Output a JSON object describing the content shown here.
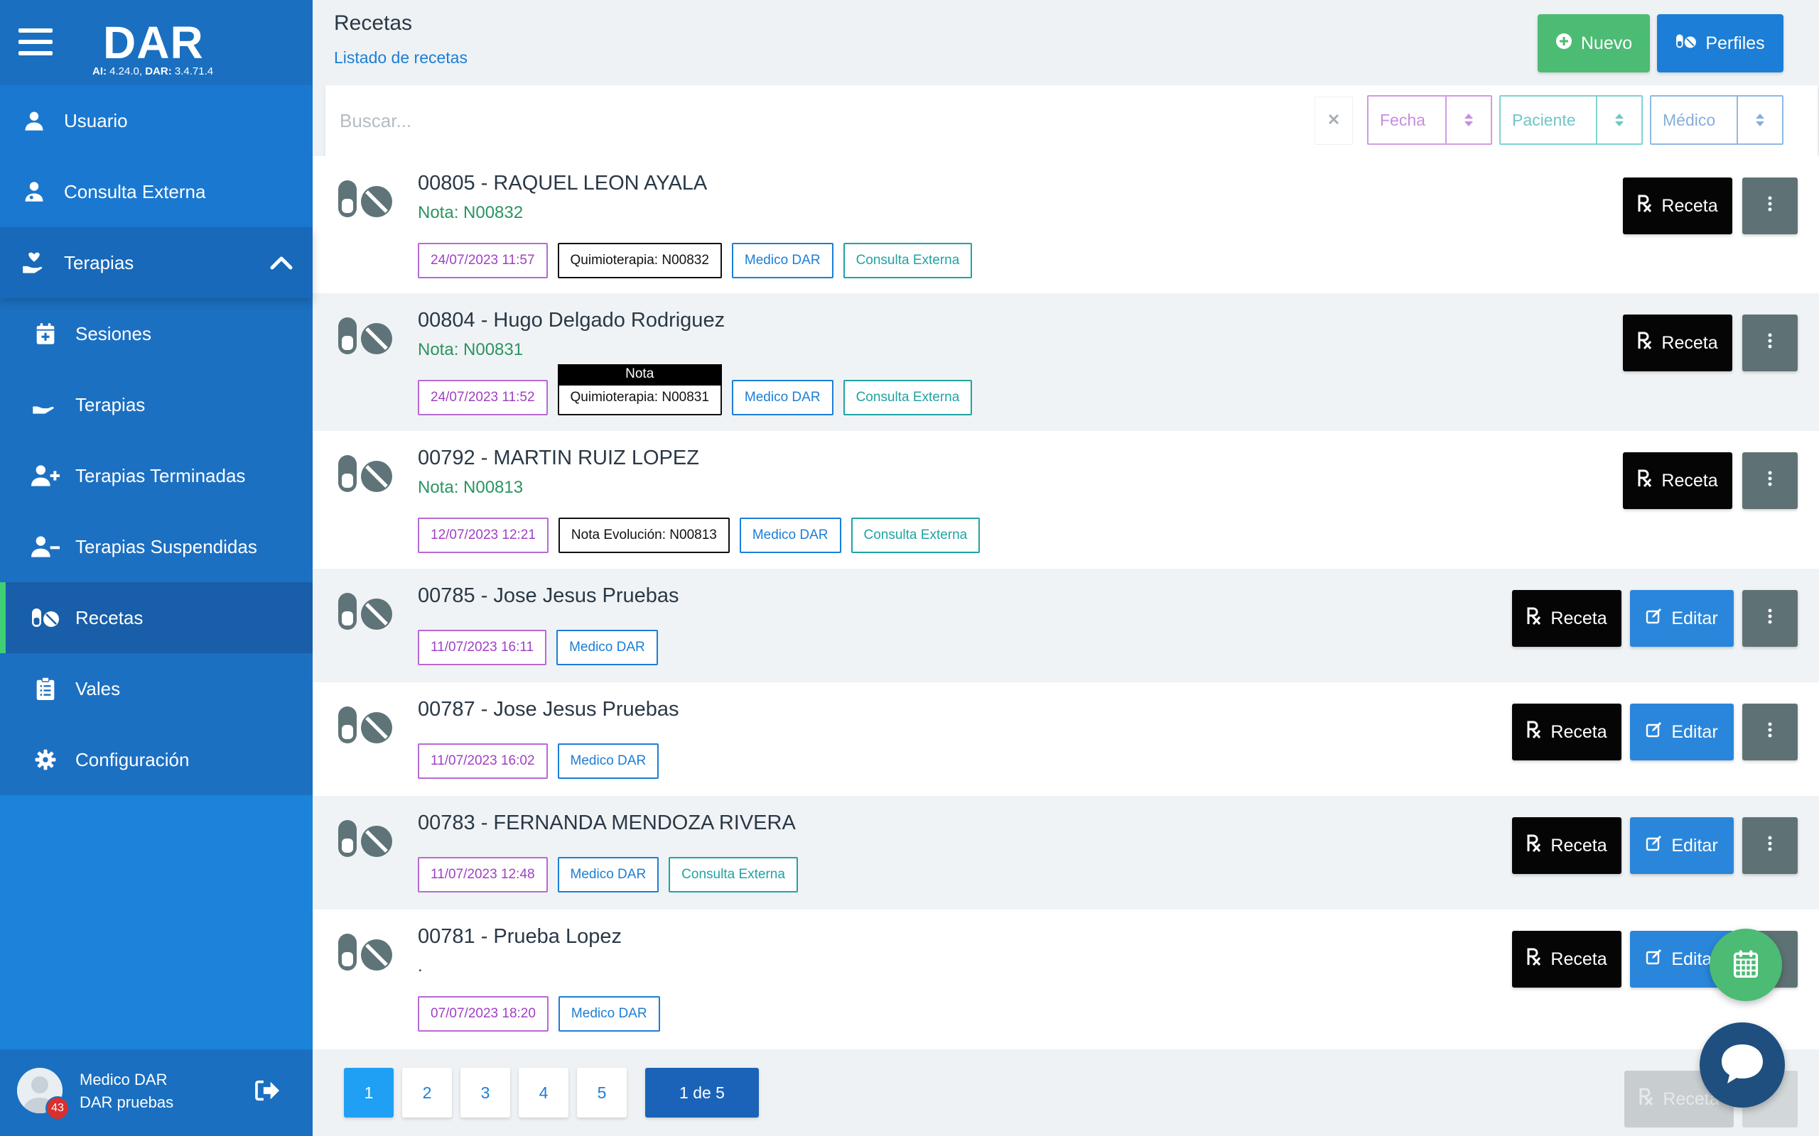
{
  "brand": {
    "logo": "DAR",
    "ai_label": "AI:",
    "ai_version": "4.24.0,",
    "dar_label": "DAR:",
    "dar_version": "3.4.71.4"
  },
  "sidebar": {
    "items": [
      {
        "label": "Usuario",
        "icon": "user-icon"
      },
      {
        "label": "Consulta Externa",
        "icon": "user-doctor-icon"
      },
      {
        "label": "Terapias",
        "icon": "hand-holding-heart-icon"
      },
      {
        "label": "Sesiones",
        "icon": "calendar-plus-icon"
      },
      {
        "label": "Terapias",
        "icon": "hand-holding-icon"
      },
      {
        "label": "Terapias Terminadas",
        "icon": "user-plus-icon"
      },
      {
        "label": "Terapias Suspendidas",
        "icon": "user-minus-icon"
      },
      {
        "label": "Recetas",
        "icon": "pills-icon"
      },
      {
        "label": "Vales",
        "icon": "clipboard-list-icon"
      },
      {
        "label": "Configuración",
        "icon": "gear-icon"
      }
    ],
    "active": "Recetas"
  },
  "user": {
    "name": "Medico DAR",
    "org": "DAR pruebas",
    "badge": "43"
  },
  "header": {
    "title": "Recetas",
    "subtitle": "Listado de recetas",
    "nuevo_label": "Nuevo",
    "perfiles_label": "Perfiles"
  },
  "search": {
    "placeholder": "Buscar...",
    "sort_fecha": "Fecha",
    "sort_paciente": "Paciente",
    "sort_medico": "Médico"
  },
  "labels": {
    "receta": "Receta",
    "editar": "Editar",
    "tooltip_nota": "Nota"
  },
  "rows": [
    {
      "title": "00805 - RAQUEL LEON AYALA",
      "nota": "Nota: N00832",
      "date": "24/07/2023 11:57",
      "ref": "Quimioterapia: N00832",
      "medico": "Medico DAR",
      "consulta": "Consulta Externa"
    },
    {
      "title": "00804 - Hugo Delgado Rodriguez",
      "nota": "Nota: N00831",
      "date": "24/07/2023 11:52",
      "ref": "Quimioterapia: N00831",
      "medico": "Medico DAR",
      "consulta": "Consulta Externa"
    },
    {
      "title": "00792 - MARTIN RUIZ LOPEZ",
      "nota": "Nota: N00813",
      "date": "12/07/2023 12:21",
      "ref": "Nota Evolución: N00813",
      "medico": "Medico DAR",
      "consulta": "Consulta Externa"
    },
    {
      "title": "00785 - Jose Jesus Pruebas",
      "date": "11/07/2023 16:11",
      "medico": "Medico DAR"
    },
    {
      "title": "00787 - Jose Jesus Pruebas",
      "date": "11/07/2023 16:02",
      "medico": "Medico DAR"
    },
    {
      "title": "00783 - FERNANDA MENDOZA RIVERA",
      "date": "11/07/2023 12:48",
      "medico": "Medico DAR",
      "consulta": "Consulta Externa"
    },
    {
      "title": "00781 - Prueba Lopez",
      "nota": ".",
      "date": "07/07/2023 18:20",
      "medico": "Medico DAR"
    }
  ],
  "pagination": {
    "pages": [
      "1",
      "2",
      "3",
      "4",
      "5"
    ],
    "current": "1",
    "info": "1 de 5"
  },
  "colors": {
    "sidebar": "#1b83d9",
    "brand": "#1a6fc0",
    "success": "#4cbb74",
    "primary": "#1c7ed6",
    "dark": "#050505",
    "more": "#5e7275"
  }
}
